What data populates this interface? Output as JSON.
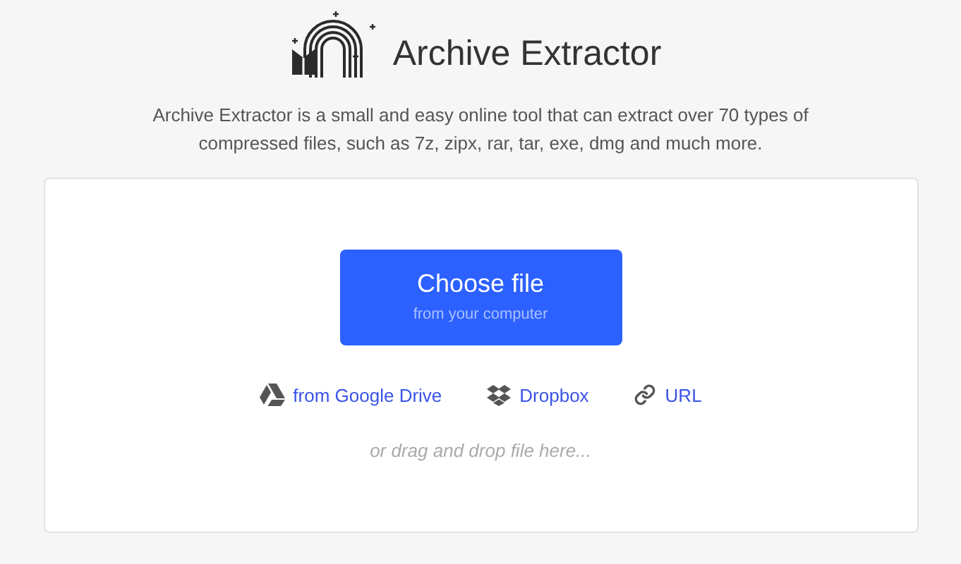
{
  "header": {
    "title": "Archive Extractor"
  },
  "description": "Archive Extractor is a small and easy online tool that can extract over 70 types of compressed files, such as 7z, zipx, rar, tar, exe, dmg and much more.",
  "upload": {
    "button": {
      "label": "Choose file",
      "sublabel": "from your computer"
    },
    "sources": [
      {
        "kind": "drive",
        "label": "from Google Drive"
      },
      {
        "kind": "dropbox",
        "label": "Dropbox"
      },
      {
        "kind": "url",
        "label": "URL"
      }
    ],
    "drop_hint": "or drag and drop file here..."
  }
}
